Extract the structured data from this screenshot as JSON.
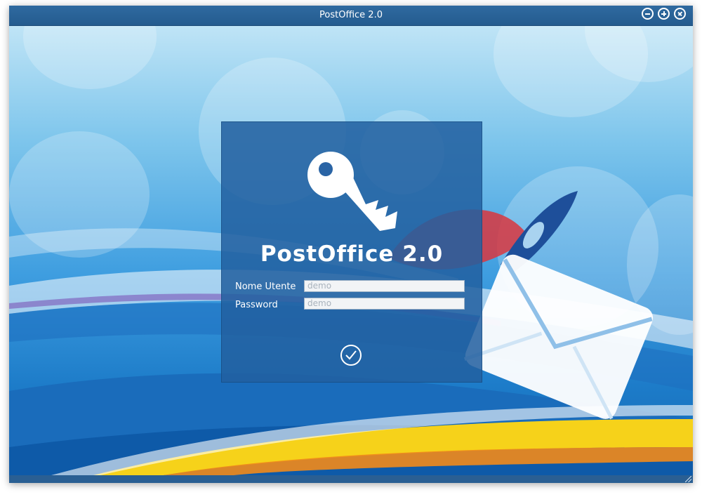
{
  "window": {
    "title": "PostOffice 2.0"
  },
  "login": {
    "brand": "PostOffice 2.0",
    "username_label": "Nome Utente",
    "username_value": "demo",
    "password_label": "Password",
    "password_value": "demo"
  },
  "icons": {
    "minimize": "minus-circle-icon",
    "maximize": "plus-circle-icon",
    "close": "close-circle-icon",
    "key": "key-icon",
    "confirm": "check-circle-icon",
    "envelope": "envelope-icon"
  },
  "colors": {
    "titlebar": "#2a6399",
    "panel": "#2260a0",
    "accent_red": "#d9363e",
    "accent_yellow": "#f4d21a"
  }
}
